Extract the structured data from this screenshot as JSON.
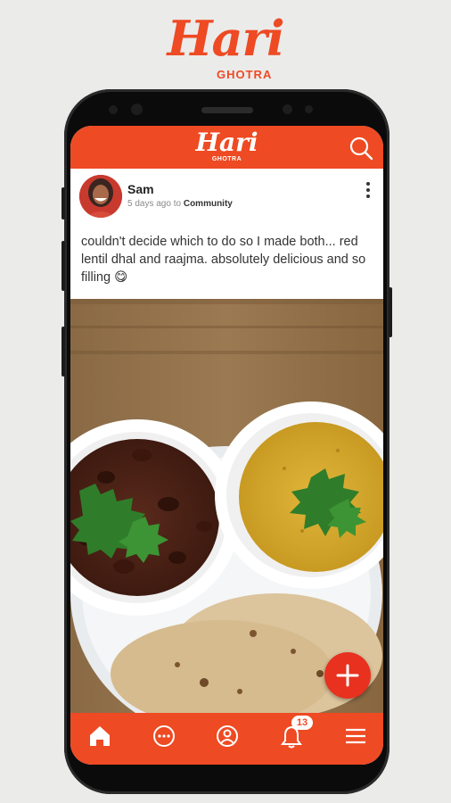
{
  "brand": {
    "name": "Hari",
    "subtitle": "GHOTRA"
  },
  "app_header": {
    "logo": "Hari",
    "logo_sub": "GHOTRA",
    "search_icon": "search-icon"
  },
  "post": {
    "author": "Sam",
    "time_ago": "5 days ago",
    "to_label": "to",
    "community": "Community",
    "text": "couldn't decide which to do so I made both... red lentil dhal and raajma. absolutely delicious and so filling 😋",
    "image_subject": "rajma-and-dal-bowls-with-chapati"
  },
  "bottom_nav": {
    "items": [
      {
        "name": "home",
        "icon": "home-icon"
      },
      {
        "name": "chat",
        "icon": "chat-icon"
      },
      {
        "name": "profile",
        "icon": "profile-icon"
      },
      {
        "name": "notifications",
        "icon": "bell-icon",
        "badge": "13"
      },
      {
        "name": "menu",
        "icon": "hamburger-menu-icon"
      }
    ]
  },
  "colors": {
    "accent": "#ee4a23",
    "fab": "#e8311f",
    "background": "#ebebea"
  }
}
